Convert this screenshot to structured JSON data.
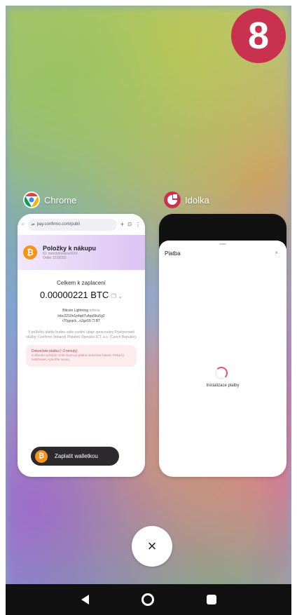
{
  "badge": "8",
  "chrome": {
    "app_name": "Chrome",
    "url": "pay.confirmo.com/publi",
    "merchant_title": "Položky k nákupu",
    "merchant_sub1": "ID: merch/invoice/XXX",
    "merchant_sub2": "Order 1510050",
    "total_label": "Celkem k zaplacení",
    "amount": "0.00000221 BTC",
    "network_label": "Bitcoin Lightning",
    "network_suffix": "adresa",
    "address_line1": "lnbc2210n1p4qd7u4pp5ku5g2",
    "address_line2": "r70gyqck...o2gz09 ❐ BT",
    "info_text": "V průběhu platby budou vaše osobní údaje zpracovány Poskytovatel služby: Confirmo (Ireland) Platební Operátor ICT, a.s. (Czech Republic)",
    "warn_title": "Dokončete platbu (~3 minuty)",
    "warn_text": "Z důvodu rychlých změn kurzu je platba omezena časem. Pokud ji nestihnete, vytvoříte novou.",
    "wallet_button": "Zaplatit walletkou"
  },
  "idolka": {
    "app_name": "Idolka",
    "sheet_title": "Platba",
    "close": "×",
    "loading_text": "Inicializace platby"
  },
  "close_all": "×",
  "colors": {
    "badge": "#c8324f",
    "warn": "#c2344e",
    "spinner": "#e05570"
  }
}
